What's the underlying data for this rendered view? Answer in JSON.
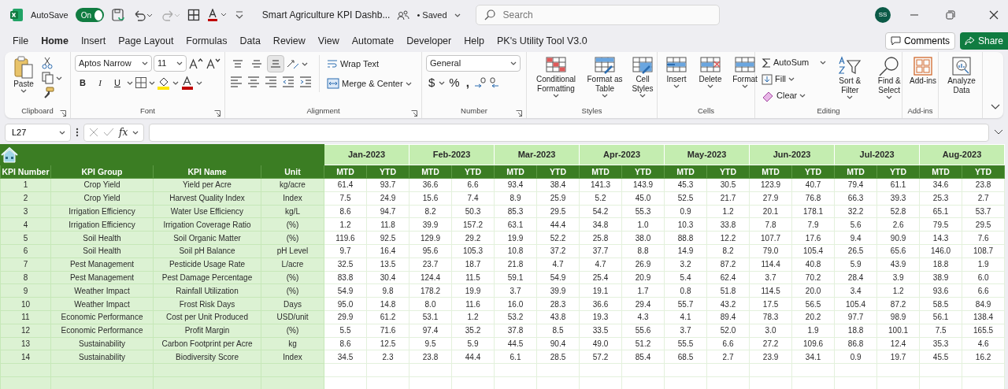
{
  "title_bar": {
    "autosave_label": "AutoSave",
    "autosave_on": true,
    "autosave_state": "On",
    "document_title": "Smart Agriculture KPI Dashb...",
    "save_status": "• Saved",
    "search_placeholder": "Search",
    "avatar": "SS"
  },
  "menu_tabs": [
    {
      "label": "File",
      "selected": false
    },
    {
      "label": "Home",
      "selected": true
    },
    {
      "label": "Insert",
      "selected": false
    },
    {
      "label": "Page Layout",
      "selected": false
    },
    {
      "label": "Formulas",
      "selected": false
    },
    {
      "label": "Data",
      "selected": false
    },
    {
      "label": "Review",
      "selected": false
    },
    {
      "label": "View",
      "selected": false
    },
    {
      "label": "Automate",
      "selected": false
    },
    {
      "label": "Developer",
      "selected": false
    },
    {
      "label": "Help",
      "selected": false
    },
    {
      "label": "PK's Utility Tool V3.0",
      "selected": false
    }
  ],
  "comments_button": "Comments",
  "share_button": "Share",
  "ribbon": {
    "clipboard": {
      "label": "Clipboard",
      "paste": "Paste"
    },
    "font": {
      "label": "Font",
      "font_name": "Aptos Narrow",
      "font_size": "11",
      "style_buttons": [
        "B",
        "I",
        "U"
      ]
    },
    "alignment": {
      "label": "Alignment",
      "vertical": [
        {
          "selected": false
        },
        {
          "selected": false
        },
        {
          "selected": true
        }
      ],
      "wrap_text": "Wrap Text",
      "merge": "Merge & Center"
    },
    "number": {
      "label": "Number",
      "format": "General",
      "symbols": [
        "$",
        "%",
        ","
      ]
    },
    "styles": {
      "label": "Styles",
      "buttons": [
        "Conditional Formatting",
        "Format as Table",
        "Cell Styles"
      ]
    },
    "cells": {
      "label": "Cells",
      "buttons": [
        "Insert",
        "Delete",
        "Format"
      ]
    },
    "editing": {
      "label": "Editing",
      "autosum": "AutoSum",
      "fill": "Fill",
      "clear": "Clear",
      "sort": "Sort & Filter",
      "find": "Find & Select"
    },
    "addins": {
      "label": "Add-ins",
      "button": "Add-ins"
    },
    "analyze": {
      "button": "Analyze Data"
    }
  },
  "formula_bar": {
    "name_box": "L27",
    "fx": "fx"
  },
  "sheet": {
    "columns": [
      "KPI Number",
      "KPI Group",
      "KPI Name",
      "Unit"
    ],
    "months": [
      {
        "label": "Jan-2023",
        "sub": [
          "MTD",
          "YTD"
        ]
      },
      {
        "label": "Feb-2023",
        "sub": [
          "MTD",
          "YTD"
        ]
      },
      {
        "label": "Mar-2023",
        "sub": [
          "MTD",
          "YTD"
        ]
      },
      {
        "label": "Apr-2023",
        "sub": [
          "MTD",
          "YTD"
        ]
      },
      {
        "label": "May-2023",
        "sub": [
          "MTD",
          "YTD"
        ]
      },
      {
        "label": "Jun-2023",
        "sub": [
          "MTD",
          "YTD"
        ]
      },
      {
        "label": "Jul-2023",
        "sub": [
          "MTD",
          "YTD"
        ]
      },
      {
        "label": "Aug-2023",
        "sub": [
          "MTD",
          "YTD"
        ]
      }
    ],
    "rows": [
      {
        "number": "1",
        "group": "Crop Yield",
        "name": "Yield per Acre",
        "unit": "kg/acre",
        "values": [
          "61.4",
          "93.7",
          "36.6",
          "6.6",
          "93.4",
          "38.4",
          "141.3",
          "143.9",
          "45.3",
          "30.5",
          "123.9",
          "40.7",
          "79.4",
          "61.1",
          "34.6",
          "23.8"
        ]
      },
      {
        "number": "2",
        "group": "Crop Yield",
        "name": "Harvest Quality Index",
        "unit": "Index",
        "values": [
          "7.5",
          "24.9",
          "15.6",
          "7.4",
          "8.9",
          "25.9",
          "5.2",
          "45.0",
          "52.5",
          "21.7",
          "27.9",
          "76.8",
          "66.3",
          "39.3",
          "25.3",
          "2.7"
        ]
      },
      {
        "number": "3",
        "group": "Irrigation Efficiency",
        "name": "Water Use Efficiency",
        "unit": "kg/L",
        "values": [
          "8.6",
          "94.7",
          "8.2",
          "50.3",
          "85.3",
          "29.5",
          "54.2",
          "55.3",
          "0.9",
          "1.2",
          "20.1",
          "178.1",
          "32.2",
          "52.8",
          "65.1",
          "53.7"
        ]
      },
      {
        "number": "4",
        "group": "Irrigation Efficiency",
        "name": "Irrigation Coverage Ratio",
        "unit": "(%)",
        "values": [
          "1.2",
          "11.8",
          "39.9",
          "157.2",
          "63.1",
          "44.4",
          "34.8",
          "1.0",
          "10.3",
          "33.8",
          "7.8",
          "7.9",
          "5.6",
          "2.6",
          "79.5",
          "29.5"
        ]
      },
      {
        "number": "5",
        "group": "Soil Health",
        "name": "Soil Organic Matter",
        "unit": "(%)",
        "values": [
          "119.6",
          "92.5",
          "129.9",
          "29.2",
          "19.9",
          "52.2",
          "25.8",
          "38.0",
          "88.8",
          "12.2",
          "107.7",
          "17.6",
          "9.4",
          "90.9",
          "14.3",
          "7.6"
        ]
      },
      {
        "number": "6",
        "group": "Soil Health",
        "name": "Soil pH Balance",
        "unit": "pH Level",
        "values": [
          "9.7",
          "16.4",
          "95.6",
          "105.3",
          "10.8",
          "37.2",
          "37.7",
          "8.8",
          "14.9",
          "8.2",
          "79.0",
          "105.4",
          "26.5",
          "65.6",
          "146.0",
          "108.7"
        ]
      },
      {
        "number": "7",
        "group": "Pest Management",
        "name": "Pesticide Usage Rate",
        "unit": "L/acre",
        "values": [
          "32.5",
          "13.5",
          "23.7",
          "18.7",
          "21.8",
          "4.7",
          "4.7",
          "26.9",
          "3.2",
          "87.2",
          "114.4",
          "40.8",
          "5.9",
          "43.9",
          "18.8",
          "1.9"
        ]
      },
      {
        "number": "8",
        "group": "Pest Management",
        "name": "Pest Damage Percentage",
        "unit": "(%)",
        "values": [
          "83.8",
          "30.4",
          "124.4",
          "11.5",
          "59.1",
          "54.9",
          "25.4",
          "20.9",
          "5.4",
          "62.4",
          "3.7",
          "70.2",
          "28.4",
          "3.9",
          "38.9",
          "6.0"
        ]
      },
      {
        "number": "9",
        "group": "Weather Impact",
        "name": "Rainfall Utilization",
        "unit": "(%)",
        "values": [
          "54.9",
          "9.8",
          "178.2",
          "19.9",
          "3.7",
          "39.9",
          "19.1",
          "1.7",
          "0.8",
          "51.8",
          "114.5",
          "20.0",
          "3.4",
          "1.2",
          "93.6",
          "6.6"
        ]
      },
      {
        "number": "10",
        "group": "Weather Impact",
        "name": "Frost Risk Days",
        "unit": "Days",
        "values": [
          "95.0",
          "14.8",
          "8.0",
          "11.6",
          "16.0",
          "28.3",
          "36.6",
          "29.4",
          "55.7",
          "43.2",
          "17.5",
          "56.5",
          "105.4",
          "87.2",
          "58.5",
          "84.9"
        ]
      },
      {
        "number": "11",
        "group": "Economic Performance",
        "name": "Cost per Unit Produced",
        "unit": "USD/unit",
        "values": [
          "29.9",
          "61.2",
          "53.1",
          "1.2",
          "53.2",
          "43.8",
          "19.3",
          "4.3",
          "4.1",
          "89.4",
          "78.3",
          "20.2",
          "97.7",
          "98.9",
          "56.1",
          "138.4"
        ]
      },
      {
        "number": "12",
        "group": "Economic Performance",
        "name": "Profit Margin",
        "unit": "(%)",
        "values": [
          "5.5",
          "71.6",
          "97.4",
          "35.2",
          "37.8",
          "8.5",
          "33.5",
          "55.6",
          "3.7",
          "52.0",
          "3.0",
          "1.9",
          "18.8",
          "100.1",
          "7.5",
          "165.5"
        ]
      },
      {
        "number": "13",
        "group": "Sustainability",
        "name": "Carbon Footprint per Acre",
        "unit": "kg",
        "values": [
          "8.6",
          "12.5",
          "9.5",
          "5.9",
          "44.5",
          "90.4",
          "49.0",
          "51.2",
          "55.5",
          "6.6",
          "27.2",
          "109.6",
          "86.8",
          "12.4",
          "35.3",
          "4.6"
        ]
      },
      {
        "number": "14",
        "group": "Sustainability",
        "name": "Biodiversity Score",
        "unit": "Index",
        "values": [
          "34.5",
          "2.3",
          "23.8",
          "44.4",
          "6.1",
          "28.5",
          "57.2",
          "85.4",
          "68.5",
          "2.7",
          "23.9",
          "34.1",
          "0.9",
          "19.7",
          "45.5",
          "16.2"
        ]
      }
    ]
  }
}
